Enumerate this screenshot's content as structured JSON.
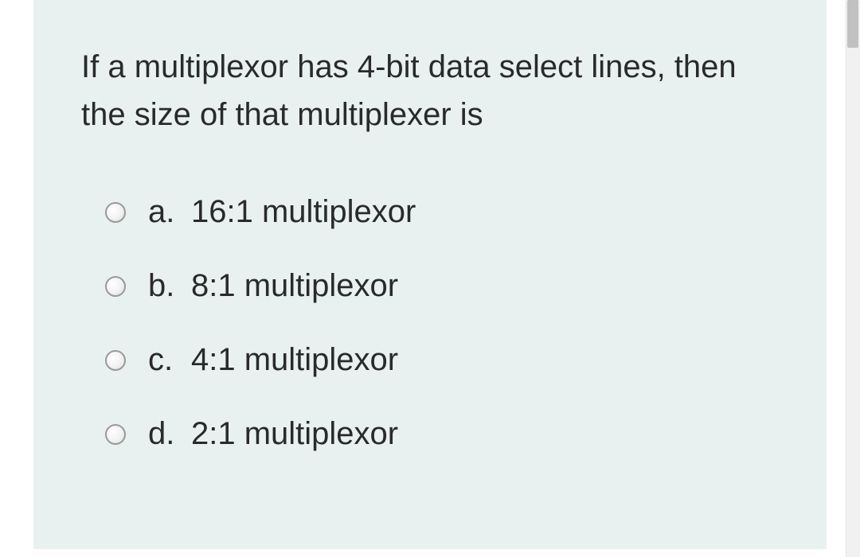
{
  "question": {
    "text": "If a multiplexor has 4-bit data select lines, then the size of that multiplexer is",
    "options": [
      {
        "letter": "a.",
        "text": "16:1 multiplexor"
      },
      {
        "letter": "b.",
        "text": "8:1 multiplexor"
      },
      {
        "letter": "c.",
        "text": "4:1 multiplexor"
      },
      {
        "letter": "d.",
        "text": "2:1 multiplexor"
      }
    ]
  }
}
